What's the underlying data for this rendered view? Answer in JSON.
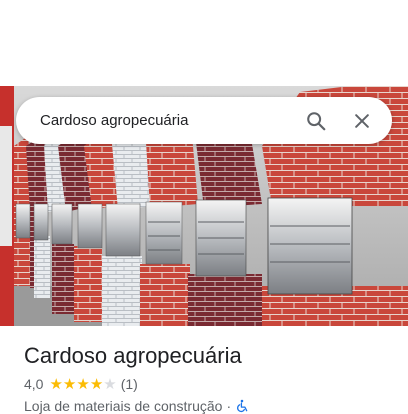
{
  "search": {
    "query": "Cardoso agropecuária",
    "search_icon": "search-icon",
    "close_icon": "close-icon"
  },
  "place": {
    "name": "Cardoso agropecuária",
    "rating": "4,0",
    "stars_value": 4,
    "stars_max": 5,
    "review_count": "(1)",
    "category": "Loja de materiais de construção",
    "separator": "·",
    "accessibility_icon": "wheelchair-icon"
  },
  "colors": {
    "star": "#fbbc04",
    "star_empty": "#dadce0",
    "title": "#202124",
    "secondary": "#5f6368",
    "accessibility": "#1a73e8"
  }
}
